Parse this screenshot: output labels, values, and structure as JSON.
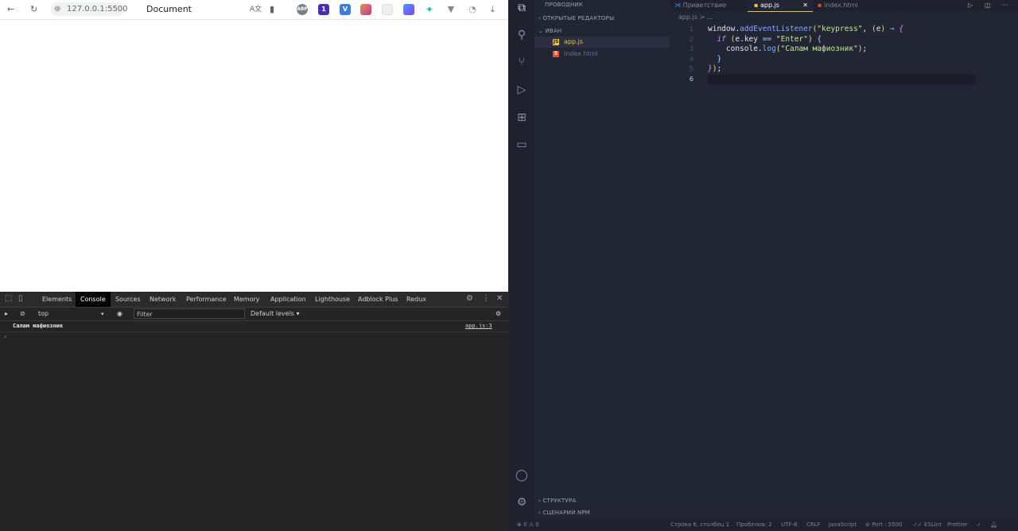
{
  "browser": {
    "url": "127.0.0.1:5500",
    "tab_title": "Document",
    "extensions": [
      {
        "name": "abp",
        "label": "ABP",
        "color": "#7a7f86"
      },
      {
        "name": "ext2",
        "label": "1",
        "color": "#4b2db3"
      },
      {
        "name": "ext3",
        "label": "V",
        "color": "#3b7ddd"
      },
      {
        "name": "ext4",
        "label": "",
        "color": "#e0559c"
      },
      {
        "name": "ext5",
        "label": "",
        "color": "#e5e5e5"
      },
      {
        "name": "ext6",
        "label": "",
        "color": "#5a5ce8"
      },
      {
        "name": "ext7",
        "label": "",
        "color": "#1fbfa5"
      },
      {
        "name": "ext8",
        "label": "",
        "color": "#888888"
      },
      {
        "name": "ext9",
        "label": "",
        "color": "#cccccc"
      }
    ]
  },
  "devtools": {
    "tabs": [
      "Elements",
      "Console",
      "Sources",
      "Network",
      "Performance",
      "Memory",
      "Application",
      "Lighthouse",
      "Adblock Plus",
      "Redux"
    ],
    "active_tab": "Console",
    "context": "top",
    "filter_placeholder": "Filter",
    "levels": "Default levels ▾",
    "log_message": "Салам мафиозник",
    "log_source": "app.js:3",
    "prompt": "›"
  },
  "vscode": {
    "explorer_title": "ПРОВОДНИК",
    "open_editors": "ОТКРЫТЫЕ РЕДАКТОРЫ",
    "folder": "ИВАН",
    "files": [
      {
        "name": "app.js",
        "type": "js",
        "active": true
      },
      {
        "name": "index.html",
        "type": "html",
        "active": false
      }
    ],
    "outline": "СТРУКТУРА",
    "npm": "СЦЕНАРИИ NPM",
    "tabs": [
      {
        "label": "Приветствие",
        "active": false
      },
      {
        "label": "app.js",
        "active": true
      },
      {
        "label": "index.html",
        "active": false
      }
    ],
    "breadcrumb": "app.js > ...",
    "line_numbers": [
      "1",
      "2",
      "3",
      "4",
      "5",
      "6"
    ],
    "status": {
      "errors": "⊗ 0 ⚠ 0",
      "position": "Строка 6, столбец 1",
      "spaces": "Пробелов: 2",
      "encoding": "UTF-8",
      "eol": "CRLF",
      "language": "JavaScript",
      "port": "⊘ Port : 5500",
      "eslint": "✓✓ ESLint",
      "prettier": "Prettier"
    }
  }
}
